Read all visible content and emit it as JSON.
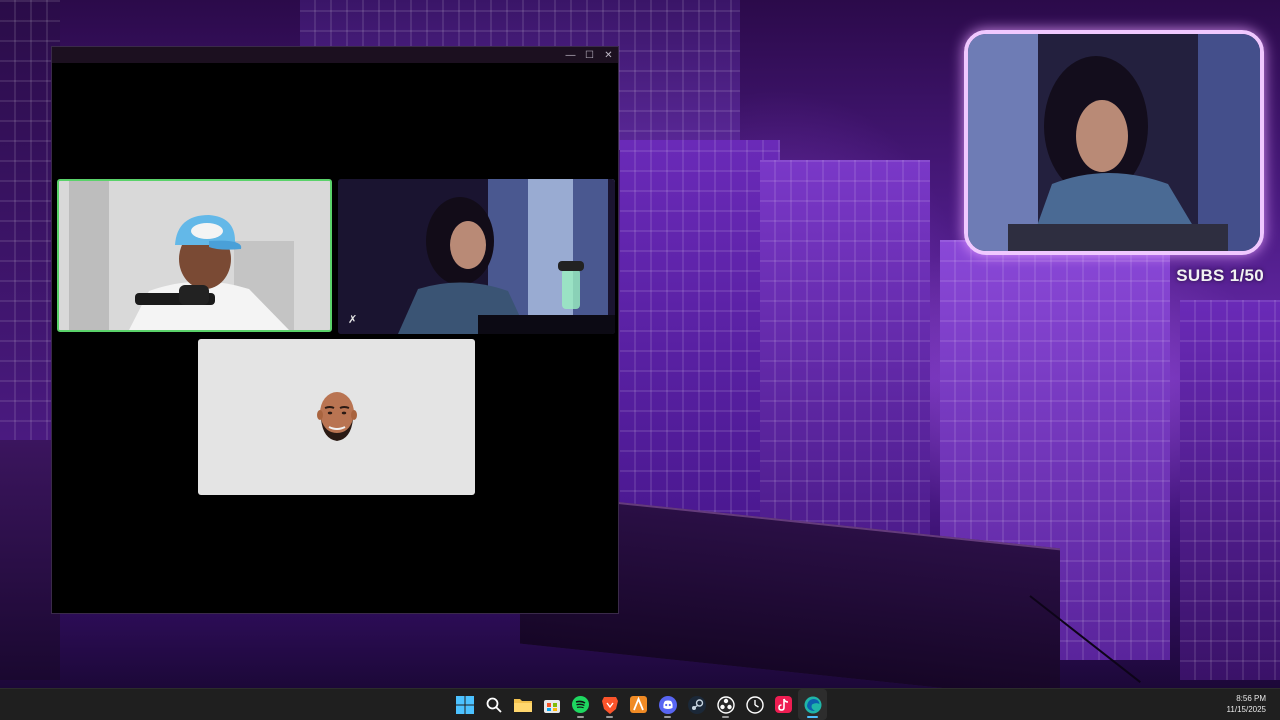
{
  "desktop": {
    "overlay": {
      "subs_label": "SUBS 1/50"
    }
  },
  "call_window": {
    "controls": {
      "minimize_symbol": "—",
      "maximize_symbol": "☐",
      "close_symbol": "✕"
    },
    "tiles": [
      {
        "name": "participant-cap-guy",
        "active_speaker": true
      },
      {
        "name": "participant-streamer",
        "muted": true
      },
      {
        "name": "participant-avatar",
        "video_off": true
      }
    ]
  },
  "taskbar": {
    "icons": [
      {
        "name": "start",
        "icon": "windows-logo-icon",
        "color": "#4cc2ff"
      },
      {
        "name": "search",
        "icon": "search-icon",
        "color": "#ffffff"
      },
      {
        "name": "file-explorer",
        "icon": "folder-icon",
        "color": "#f2c14e"
      },
      {
        "name": "microsoft-store",
        "icon": "store-icon",
        "color": "#e8e8e8"
      },
      {
        "name": "spotify",
        "icon": "spotify-icon",
        "color": "#1ed760"
      },
      {
        "name": "brave",
        "icon": "brave-icon",
        "color": "#fb542b"
      },
      {
        "name": "app-orange",
        "icon": "a-icon",
        "color": "#f08a24"
      },
      {
        "name": "discord",
        "icon": "discord-icon",
        "color": "#5865f2"
      },
      {
        "name": "steam",
        "icon": "steam-icon",
        "color": "#c7d5e0"
      },
      {
        "name": "obs",
        "icon": "settings-wheel-icon",
        "color": "#ffffff"
      },
      {
        "name": "clock-app",
        "icon": "dial-icon",
        "color": "#ffffff"
      },
      {
        "name": "tiktok",
        "icon": "tiktok-icon",
        "color": "#ee1d52"
      },
      {
        "name": "edge",
        "icon": "edge-icon",
        "color": "#1fb5a8"
      }
    ],
    "clock": {
      "time": "8:56 PM",
      "date": "11/15/2025"
    }
  }
}
